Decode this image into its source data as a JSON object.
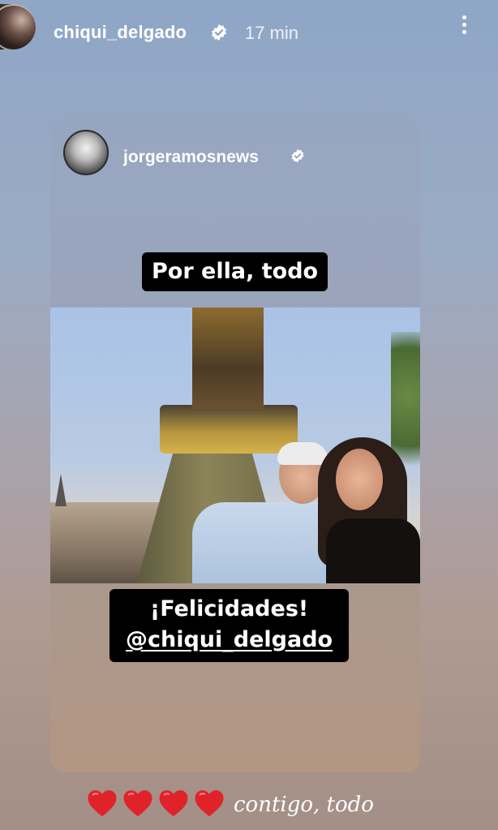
{
  "header": {
    "username": "chiqui_delgado",
    "timestamp": "17 min",
    "verified_icon": "verified-badge-icon",
    "more_icon": "more-vertical-icon"
  },
  "shared_post": {
    "author": "jorgeramosnews",
    "author_verified": true,
    "caption_top": "Por ella, todo",
    "caption_bottom_line1": "¡Felicidades!",
    "caption_bottom_line2": "@chiqui_delgado",
    "photo_description_icon": "photo"
  },
  "reply": {
    "emoji": [
      "❤️",
      "❤️",
      "❤️",
      "❤️"
    ],
    "text": "contigo, todo"
  },
  "colors": {
    "heart": "#e0232b",
    "caption_bg": "#000000",
    "text": "#ffffff"
  }
}
